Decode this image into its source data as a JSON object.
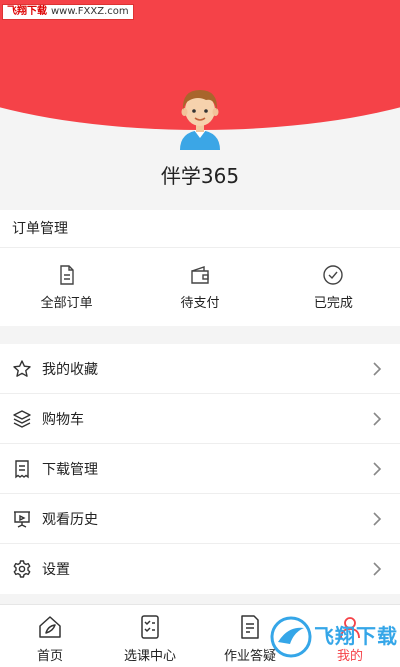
{
  "watermark": {
    "brand": "飞翔下载",
    "url": "www.FXXZ.com"
  },
  "profile": {
    "name": "伴学365"
  },
  "orders": {
    "title": "订单管理",
    "items": [
      {
        "label": "全部订单",
        "icon": "document-icon"
      },
      {
        "label": "待支付",
        "icon": "wallet-icon"
      },
      {
        "label": "已完成",
        "icon": "check-circle-icon"
      }
    ]
  },
  "menu": {
    "items": [
      {
        "label": "我的收藏",
        "icon": "star-icon"
      },
      {
        "label": "购物车",
        "icon": "layers-icon"
      },
      {
        "label": "下载管理",
        "icon": "receipt-icon"
      },
      {
        "label": "观看历史",
        "icon": "presentation-icon"
      },
      {
        "label": "设置",
        "icon": "gear-icon"
      }
    ]
  },
  "tabbar": {
    "items": [
      {
        "label": "首页",
        "icon": "home-icon"
      },
      {
        "label": "选课中心",
        "icon": "checklist-icon"
      },
      {
        "label": "作业答疑",
        "icon": "homework-icon"
      },
      {
        "label": "我的",
        "icon": "profile-icon"
      }
    ]
  },
  "logo_watermark": {
    "text": "飞翔下载"
  },
  "colors": {
    "accent": "#f54248",
    "background": "#f4f4f4",
    "logo_blue": "#35a6e8"
  }
}
